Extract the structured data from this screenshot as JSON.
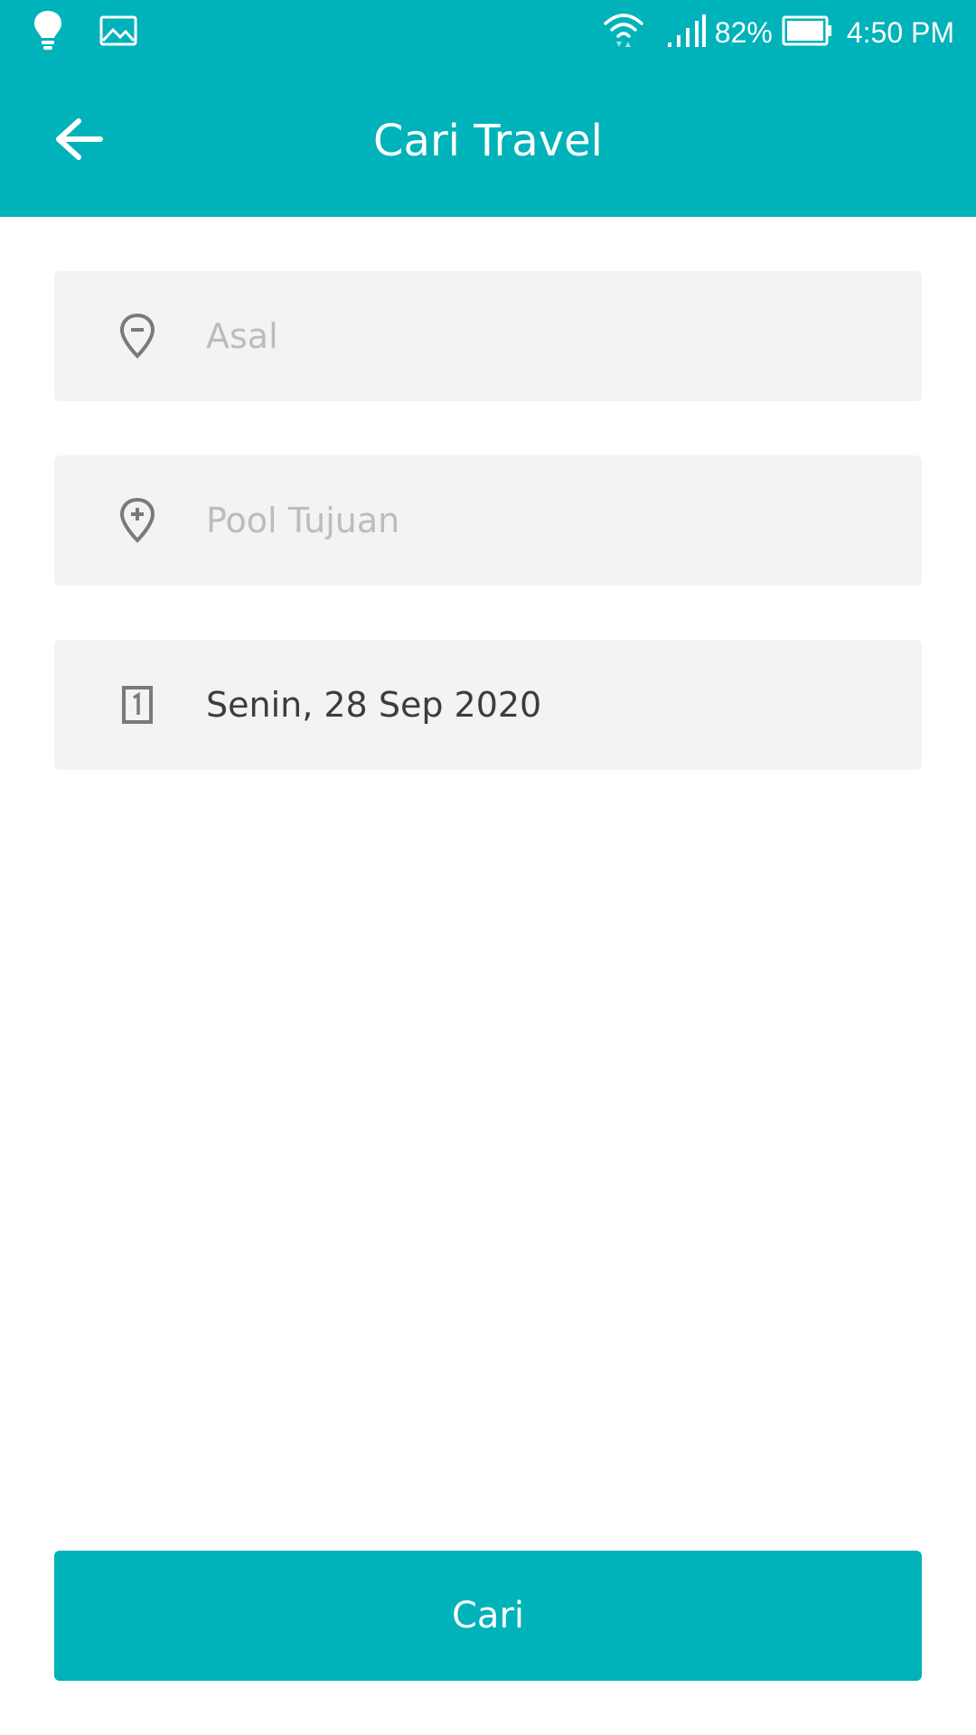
{
  "status_bar": {
    "battery_percent": "82%",
    "time": "4:50 PM",
    "icons": [
      "bulb-icon",
      "image-icon",
      "wifi-icon",
      "signal-icon",
      "battery-icon"
    ]
  },
  "app_bar": {
    "title": "Cari Travel",
    "back_icon": "arrow-left-icon"
  },
  "form": {
    "origin": {
      "placeholder": "Asal",
      "value": "",
      "icon": "location-minus-icon"
    },
    "destination": {
      "placeholder": "Pool Tujuan",
      "value": "",
      "icon": "location-plus-icon"
    },
    "date": {
      "value": "Senin, 28 Sep 2020",
      "icon": "calendar-icon"
    }
  },
  "search_button": {
    "label": "Cari"
  },
  "colors": {
    "primary": "#00b2b9",
    "field_bg": "#f3f3f3",
    "placeholder": "#bcbcbc",
    "text": "#3c3c3c",
    "icon": "#7a7a7a"
  }
}
